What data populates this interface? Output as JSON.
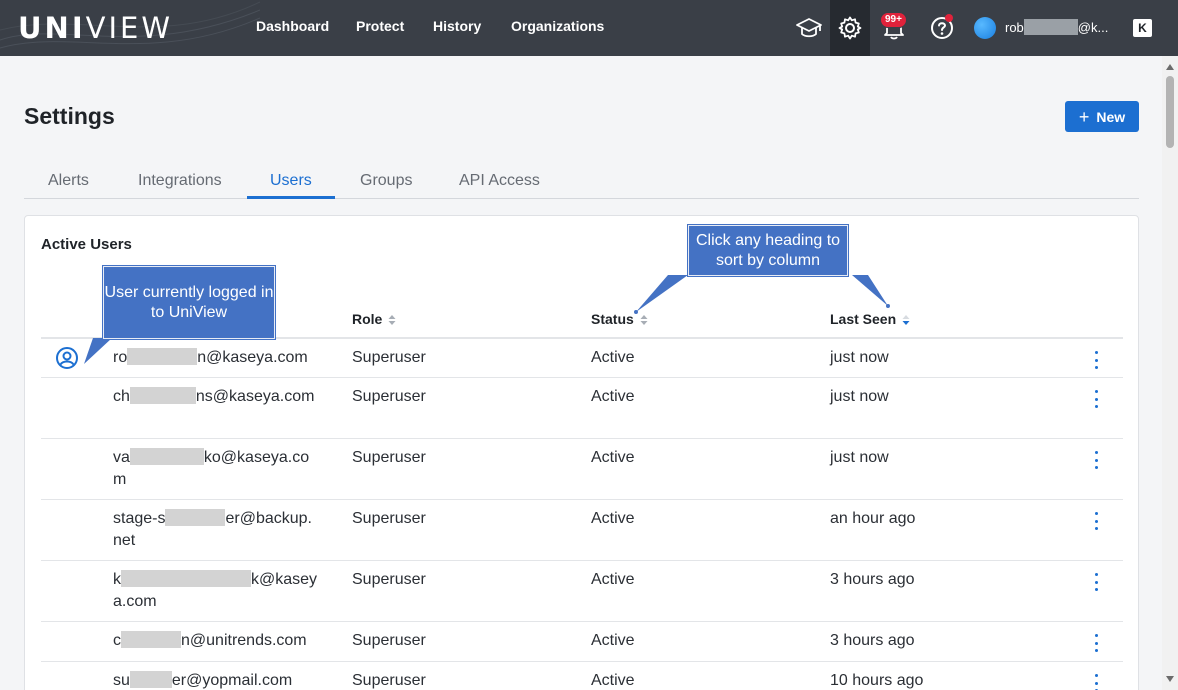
{
  "brand": {
    "bold": "UNI",
    "light": "VIEW"
  },
  "nav": [
    {
      "label": "Dashboard"
    },
    {
      "label": "Protect"
    },
    {
      "label": "History"
    },
    {
      "label": "Organizations"
    }
  ],
  "header_icons": {
    "academy": "graduation-cap-icon",
    "settings": "gear-icon",
    "notifications": "bell-icon",
    "help": "question-circle-icon"
  },
  "notifications": {
    "badge": "99+"
  },
  "account": {
    "email_prefix": "rob",
    "email_suffix": "@k..."
  },
  "page": {
    "title": "Settings",
    "new_button": "New"
  },
  "tabs": [
    {
      "label": "Alerts",
      "active": false
    },
    {
      "label": "Integrations",
      "active": false
    },
    {
      "label": "Users",
      "active": true
    },
    {
      "label": "Groups",
      "active": false
    },
    {
      "label": "API Access",
      "active": false
    }
  ],
  "table": {
    "title": "Active Users",
    "columns": {
      "role": "Role",
      "status": "Status",
      "last_seen": "Last Seen"
    },
    "sort": {
      "column": "Last Seen",
      "direction": "descending"
    },
    "rows": [
      {
        "email_a": "ro",
        "email_b": "n@kaseya.com",
        "role": "Superuser",
        "status": "Active",
        "last_seen": "just now",
        "current": true
      },
      {
        "email_a": "ch",
        "email_b": "ns@kaseya.com",
        "role": "Superuser",
        "status": "Active",
        "last_seen": "just now",
        "current": false
      },
      {
        "email_a": "va",
        "email_b": "ko@kaseya.com",
        "role": "Superuser",
        "status": "Active",
        "last_seen": "just now",
        "current": false
      },
      {
        "email_a": "stage-s",
        "email_b": "er@backup.net",
        "role": "Superuser",
        "status": "Active",
        "last_seen": "an hour ago",
        "current": false
      },
      {
        "email_a": "k",
        "email_b": "k@kaseya.com",
        "role": "Superuser",
        "status": "Active",
        "last_seen": "3 hours ago",
        "current": false
      },
      {
        "email_a": "c",
        "email_b": "n@unitrends.com",
        "role": "Superuser",
        "status": "Active",
        "last_seen": "3 hours ago",
        "current": false
      },
      {
        "email_a": "su",
        "email_b": "er@yopmail.com",
        "role": "Superuser",
        "status": "Active",
        "last_seen": "10 hours ago",
        "current": false
      }
    ]
  },
  "callouts": {
    "current_user": "User currently logged in to UniView",
    "sort_hint": "Click any heading to sort by column"
  },
  "colors": {
    "accent": "#1c6fd1",
    "topbar": "#3a3f47",
    "callout": "#4472c4",
    "badge": "#e0223b"
  }
}
